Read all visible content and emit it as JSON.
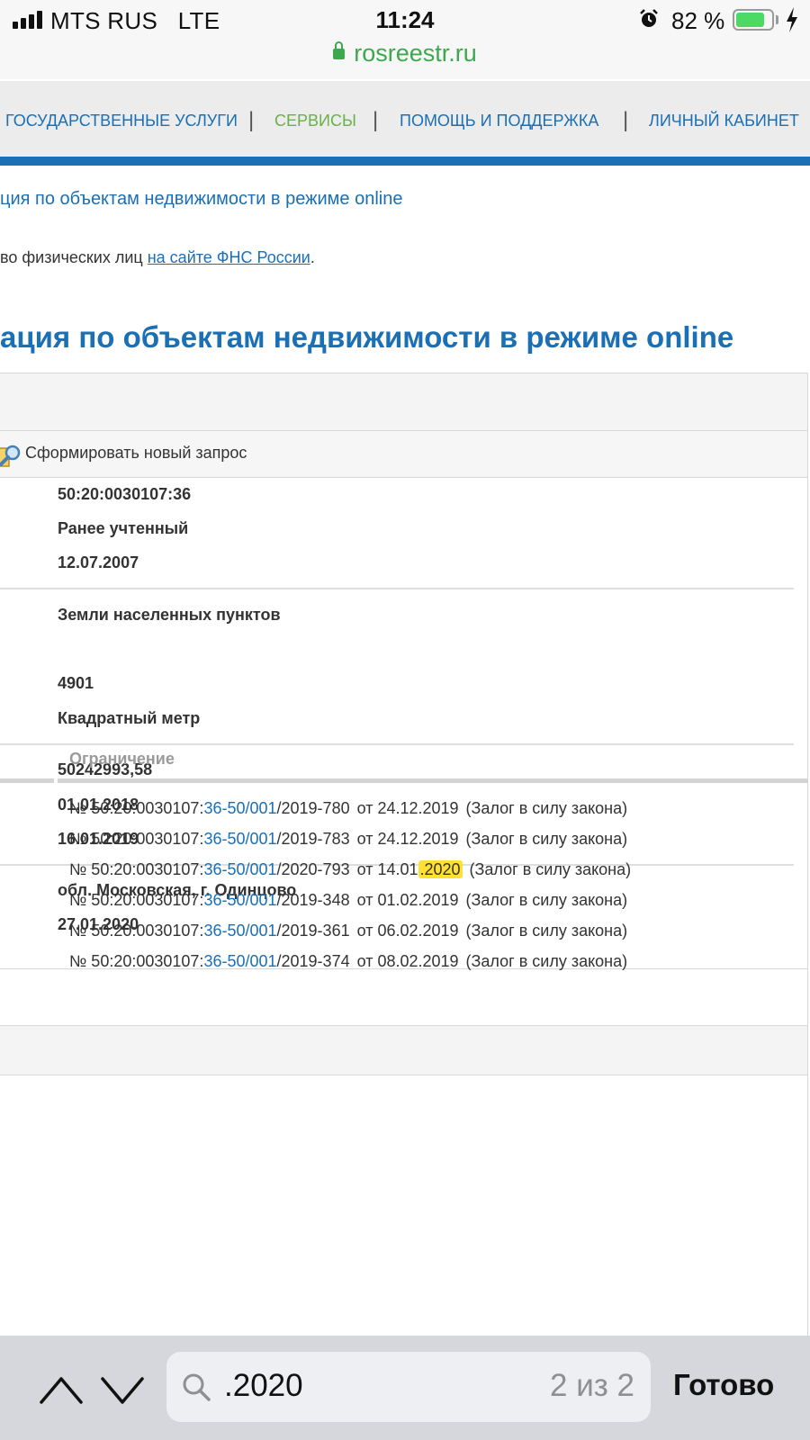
{
  "status_bar": {
    "carrier": "MTS RUS",
    "network": "LTE",
    "time": "11:24",
    "battery_percent": "82 %",
    "battery_level": 0.82,
    "url": "rosreestr.ru",
    "icons": [
      "signal-icon",
      "alarm-icon",
      "battery-icon",
      "charging-bolt-icon",
      "lock-icon"
    ]
  },
  "nav": {
    "items": [
      "ГОСУДАРСТВЕННЫЕ УСЛУГИ",
      "СЕРВИСЫ",
      "ПОМОЩЬ И ПОДДЕРЖКА",
      "ЛИЧНЫЙ КАБИНЕТ"
    ],
    "separator": "|",
    "active": "СЕРВИСЫ"
  },
  "breadcrumb": "ция по объектам недвижимости в режиме online",
  "notice": {
    "text_before": "во физических лиц ",
    "link": "на сайте ФНС России",
    "text_after": "."
  },
  "heading": "ация по объектам недвижимости в режиме online",
  "new_request_label": "Сформировать новый запрос",
  "object": {
    "cadastral_number": "50:20:0030107:36",
    "status": "Ранее учтенный",
    "registration_date": "12.07.2007",
    "land_category": "Земли населенных пунктов",
    "area": "4901",
    "area_unit": "Квадратный метр",
    "cadastral_value": "50242993,58",
    "value_date": "01.01.2018",
    "value_entered_date": "16.01.2019",
    "address": "обл. Московская, г. Одинцово",
    "update_date": "27.01.2020"
  },
  "restrictions": {
    "column_header": "Ограничение",
    "rows": [
      {
        "prefix": "№ 50:20:0030107:",
        "link": "36-50/001",
        "suffix": "/2019-780",
        "date_label": "от 24.12.2019",
        "date_highlight": "",
        "type": "(Залог в силу закона)"
      },
      {
        "prefix": "№ 50:20:0030107:",
        "link": "36-50/001",
        "suffix": "/2019-783",
        "date_label": "от 24.12.2019",
        "date_highlight": "",
        "type": "(Залог в силу закона)"
      },
      {
        "prefix": "№ 50:20:0030107:",
        "link": "36-50/001",
        "suffix": "/2020-793",
        "date_label": "от 14.01",
        "date_highlight": ".2020",
        "type": "(Залог в силу закона)"
      },
      {
        "prefix": "№ 50:20:0030107:",
        "link": "36-50/001",
        "suffix": "/2019-348",
        "date_label": "от 01.02.2019",
        "date_highlight": "",
        "type": "(Залог в силу закона)"
      },
      {
        "prefix": "№ 50:20:0030107:",
        "link": "36-50/001",
        "suffix": "/2019-361",
        "date_label": "от 06.02.2019",
        "date_highlight": "",
        "type": "(Залог в силу закона)"
      },
      {
        "prefix": "№ 50:20:0030107:",
        "link": "36-50/001",
        "suffix": "/2019-374",
        "date_label": "от 08.02.2019",
        "date_highlight": "",
        "type": "(Залог в силу закона)"
      }
    ]
  },
  "find_bar": {
    "query": ".2020",
    "match_count": "2 из 2",
    "done_label": "Готово",
    "highlight_color": "#ffe033"
  },
  "colors": {
    "link_blue": "#1a6fb5",
    "active_green": "#6ab04c",
    "url_green": "#3ba94e",
    "battery_green": "#4cd964"
  }
}
